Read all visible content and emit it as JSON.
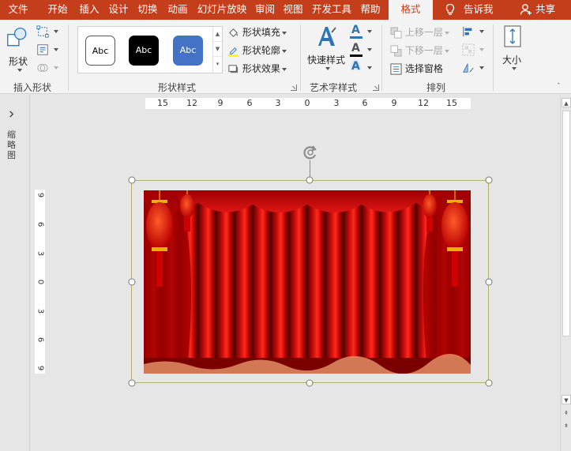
{
  "tabs": [
    "文件",
    "开始",
    "插入",
    "设计",
    "切换",
    "动画",
    "幻灯片放映",
    "审阅",
    "视图",
    "开发工具",
    "帮助",
    "格式"
  ],
  "tell_me": "告诉我",
  "share": "共享",
  "ribbon": {
    "insert_shapes": {
      "shape_label": "形状",
      "group_label": "插入形状"
    },
    "shape_styles": {
      "samples": [
        "Abc",
        "Abc",
        "Abc"
      ],
      "fill": "形状填充",
      "outline": "形状轮廓",
      "effects": "形状效果",
      "group_label": "形状样式"
    },
    "wordart": {
      "quick_styles": "快速样式",
      "group_label": "艺术字样式"
    },
    "arrange": {
      "bring_forward": "上移一层",
      "send_backward": "下移一层",
      "selection_pane": "选择窗格",
      "group_label": "排列"
    },
    "size": {
      "label": "大小"
    }
  },
  "thumbnail_pane_label": "缩略图",
  "ruler": {
    "horizontal": [
      "15",
      "12",
      "9",
      "6",
      "3",
      "0",
      "3",
      "6",
      "9",
      "12",
      "15"
    ],
    "vertical": [
      "9",
      "6",
      "3",
      "0",
      "3",
      "6",
      "9"
    ]
  },
  "colors": {
    "tab_bar": "#c43e1c",
    "ribbon": "#f3f3f3",
    "canvas": "#e6e6e6",
    "style_blue": "#4472c4",
    "curtain_red": "#c40000"
  }
}
